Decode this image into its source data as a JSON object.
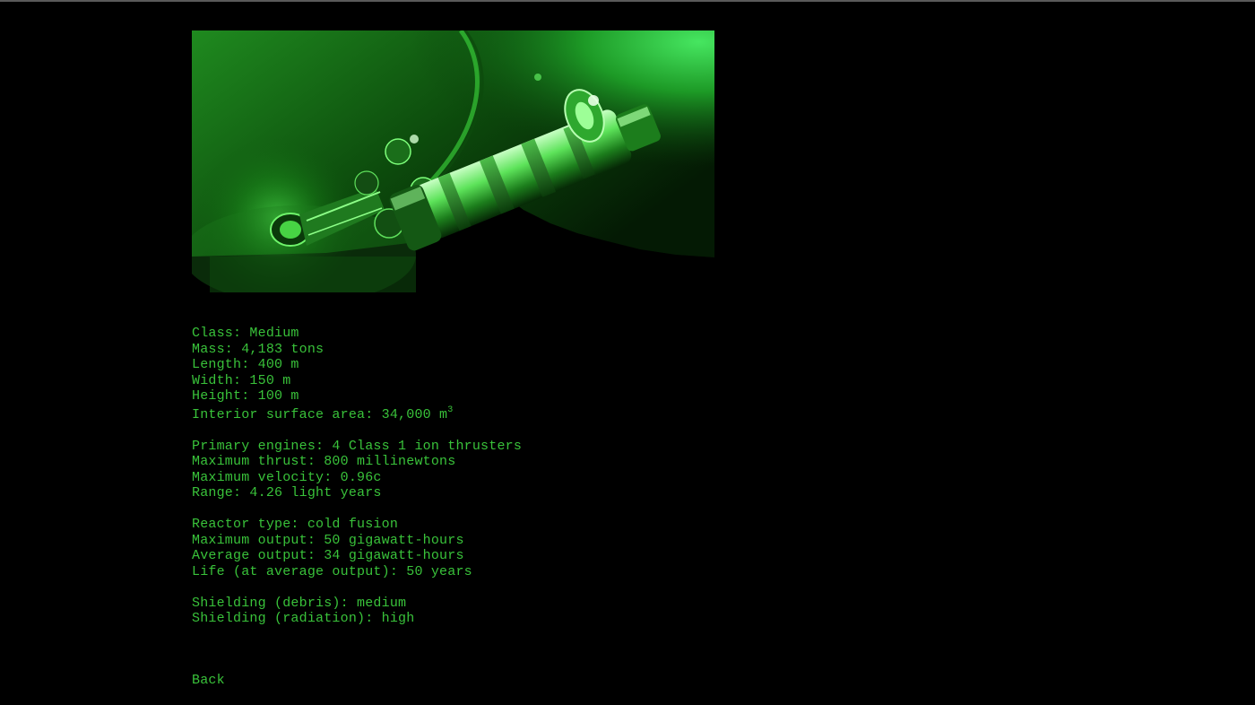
{
  "colors": {
    "background": "#000000",
    "text": "#39c23a",
    "glow": "#3df04a"
  },
  "image": {
    "subject": "spaceship-render"
  },
  "specs": {
    "hull": {
      "class": "Class: Medium",
      "mass": "Mass: 4,183 tons",
      "length": "Length: 400 m",
      "width": "Width: 150 m",
      "height": "Height: 100 m",
      "area_prefix": "Interior surface area: 34,000 m",
      "area_exponent": "3"
    },
    "propulsion": {
      "engines": "Primary engines: 4 Class 1 ion thrusters",
      "thrust": "Maximum thrust: 800 millinewtons",
      "velocity": "Maximum velocity: 0.96c",
      "range": "Range: 4.26 light years"
    },
    "reactor": {
      "type": "Reactor type: cold fusion",
      "max_output": "Maximum output: 50 gigawatt-hours",
      "avg_output": "Average output: 34 gigawatt-hours",
      "life": "Life (at average output): 50 years"
    },
    "shielding": {
      "debris": "Shielding (debris): medium",
      "radiation": "Shielding (radiation): high"
    }
  },
  "nav": {
    "back_label": "Back"
  }
}
